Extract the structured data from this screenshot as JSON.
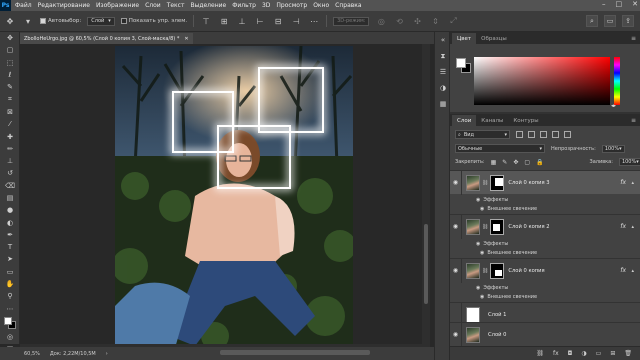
{
  "menubar": {
    "logo": "Ps",
    "items": [
      "Файл",
      "Редактирование",
      "Изображение",
      "Слои",
      "Текст",
      "Выделение",
      "Фильтр",
      "3D",
      "Просмотр",
      "Окно",
      "Справка"
    ],
    "minimize": "–",
    "maximize": "□",
    "close": "✕"
  },
  "options": {
    "autoselect_label": "Автовыбор:",
    "autoselect_target": "Слой",
    "show_transform_label": "Показать упр. элем.",
    "mode_3d_label": "3D-режим:"
  },
  "document": {
    "tab_title": "ZbolloHeUrgo.jpg @ 60,5% (Слой 0 копия 3, Слой-маска/8) *",
    "close_glyph": "✕"
  },
  "status": {
    "zoom": "60,5%",
    "doc_info": "Док: 2,22M/10,5M"
  },
  "color_panel": {
    "tabs": [
      "Цвет",
      "Образцы"
    ],
    "active_tab": 0,
    "fg_color": "#ffffff",
    "bg_color": "#000000",
    "hue_color": "#ff0000"
  },
  "layers_panel": {
    "tabs": [
      "Слои",
      "Каналы",
      "Контуры"
    ],
    "active_tab": 0,
    "filter_kind": "Вид",
    "blend_mode": "Обычные",
    "opacity_label": "Непрозрачность:",
    "opacity_value": "100%",
    "lock_label": "Закрепить:",
    "fill_label": "Заливка:",
    "fill_value": "100%",
    "layers": [
      {
        "name": "Слой 0 копия 3",
        "has_fx": true,
        "selected": true,
        "mask": "top",
        "effects_label": "Эффекты",
        "effect": "Внешнее свечение"
      },
      {
        "name": "Слой 0 копия 2",
        "has_fx": true,
        "selected": false,
        "mask": "mid",
        "effects_label": "Эффекты",
        "effect": "Внешнее свечение"
      },
      {
        "name": "Слой 0 копия",
        "has_fx": true,
        "selected": false,
        "mask": "center",
        "effects_label": "Эффекты",
        "effect": "Внешнее свечение"
      },
      {
        "name": "Слой 1",
        "has_fx": false,
        "selected": false,
        "mask": "white"
      },
      {
        "name": "Слой 0",
        "has_fx": false,
        "selected": false,
        "mask": "photo"
      }
    ],
    "fx_glyph": "fx"
  }
}
